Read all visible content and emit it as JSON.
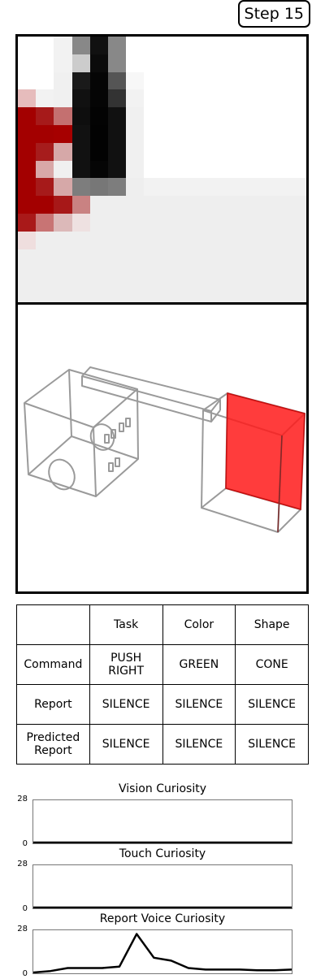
{
  "step": {
    "label": "Step 15"
  },
  "table": {
    "headers": [
      "",
      "Task",
      "Color",
      "Shape"
    ],
    "rows": [
      [
        "Command",
        "PUSH\nRIGHT",
        "GREEN",
        "CONE"
      ],
      [
        "Report",
        "SILENCE",
        "SILENCE",
        "SILENCE"
      ],
      [
        "Predicted\nReport",
        "SILENCE",
        "SILENCE",
        "SILENCE"
      ]
    ]
  },
  "chart_data": [
    {
      "type": "line",
      "title": "Vision Curiosity",
      "ylim": [
        0,
        28
      ],
      "yticks": [
        "0",
        "28"
      ],
      "values": [
        0,
        0,
        0,
        0,
        0,
        0,
        0,
        0,
        0,
        0,
        0,
        0,
        0,
        0,
        0,
        0
      ]
    },
    {
      "type": "line",
      "title": "Touch Curiosity",
      "ylim": [
        0,
        28
      ],
      "yticks": [
        "0",
        "28"
      ],
      "values": [
        0,
        0,
        0,
        0,
        0,
        0,
        0,
        0,
        0,
        0,
        0,
        0,
        0,
        0,
        0,
        0
      ]
    },
    {
      "type": "line",
      "title": "Report Voice Curiosity",
      "ylim": [
        0,
        28
      ],
      "yticks": [
        "0",
        "28"
      ],
      "values": [
        0,
        1,
        3,
        3,
        3,
        4,
        26,
        10,
        8,
        3,
        2,
        2,
        2,
        1.5,
        1.5,
        2
      ]
    }
  ],
  "colors": {
    "red": "#ff1a1a",
    "dark_red": "#a30000",
    "frame": "#000000",
    "wire": "#888888"
  }
}
